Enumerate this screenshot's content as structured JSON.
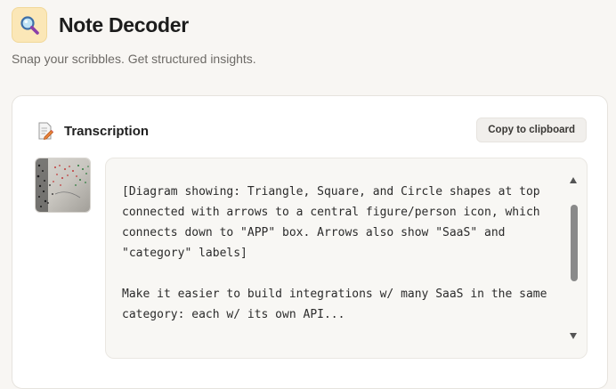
{
  "app": {
    "title": "Note Decoder",
    "tagline": "Snap your scribbles. Get structured insights.",
    "icon": "magnifying-glass-icon"
  },
  "transcription": {
    "title": "Transcription",
    "icon": "document-pencil-icon",
    "copy_label": "Copy to clipboard",
    "text": "[Diagram showing: Triangle, Square, and Circle shapes at top connected with arrows to a central figure/person icon, which connects down to \"APP\" box. Arrows also show \"SaaS\" and \"category\" labels]\n\nMake it easier to build integrations w/ many SaaS in the same category: each w/ its own API..."
  },
  "colors": {
    "background": "#f8f6f3",
    "icon_tile": "#fbe7b7",
    "card": "#ffffff"
  }
}
